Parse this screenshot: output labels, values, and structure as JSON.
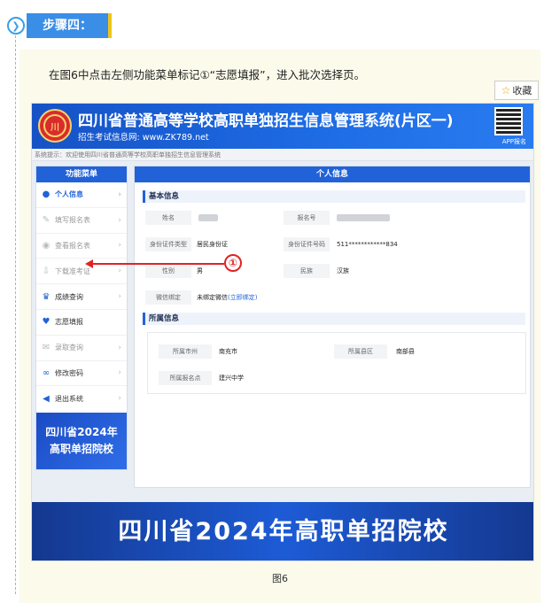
{
  "step": {
    "icon": "chevron-right-icon",
    "label": "步骤四："
  },
  "intro_text": "在图6中点击左侧功能菜单标记①“志愿填报”，进入批次选择页。",
  "favorite": {
    "icon": "star-icon",
    "label": "收藏"
  },
  "screenshot": {
    "system_title": "四川省普通高等学校高职单独招生信息管理系统(片区一)",
    "system_subtitle": "招生考试信息网: www.ZK789.net",
    "app_label": "APP报名",
    "notice": "系统提示：欢迎使用四川省普通高等学校高职单独招生信息管理系统",
    "menu": {
      "header": "功能菜单",
      "items": [
        {
          "label": "个人信息",
          "icon": "user-icon"
        },
        {
          "label": "填写报名表",
          "icon": "edit-icon"
        },
        {
          "label": "查看报名表",
          "icon": "eye-icon"
        },
        {
          "label": "下载准考证",
          "icon": "download-icon"
        },
        {
          "label": "成绩查询",
          "icon": "trophy-icon"
        },
        {
          "label": "志愿填报",
          "icon": "heart-icon"
        },
        {
          "label": "录取查询",
          "icon": "mail-icon"
        },
        {
          "label": "修改密码",
          "icon": "link-icon"
        },
        {
          "label": "退出系统",
          "icon": "back-icon"
        }
      ],
      "promo_line1": "四川省2024年",
      "promo_line2": "高职单招院校"
    },
    "info": {
      "header": "个人信息",
      "basic_title": "基本信息",
      "name_label": "姓名",
      "regno_label": "报名号",
      "idtype_label": "身份证件类型",
      "idtype_value": "居民身份证",
      "idno_label": "身份证件号码",
      "idno_value": "511************834",
      "gender_label": "性别",
      "gender_value": "男",
      "nation_label": "民族",
      "nation_value": "汉族",
      "wechat_label": "微信绑定",
      "wechat_value": "未绑定微信",
      "wechat_link": "(立即绑定)",
      "affil_title": "所属信息",
      "city_label": "所属市州",
      "city_value": "南充市",
      "county_label": "所属县区",
      "county_value": "南部县",
      "site_label": "所属报名点",
      "site_value": "建兴中学"
    },
    "marker": "①",
    "bottom_banner": "四川省2024年高职单招院校"
  },
  "caption": "图6"
}
